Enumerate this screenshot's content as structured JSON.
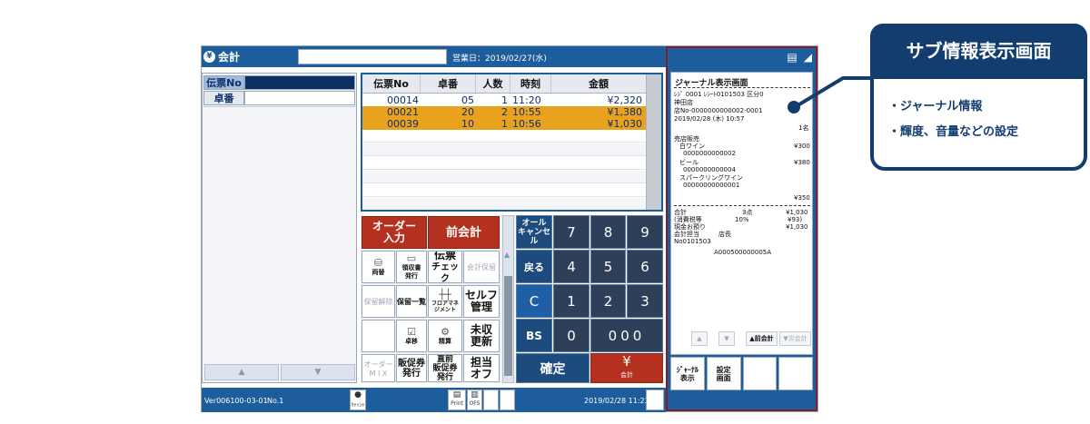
{
  "app": {
    "title": "会計",
    "business_date": "営業日：2019/02/27(水)"
  },
  "left_panel": {
    "rows": [
      {
        "label": "伝票No"
      },
      {
        "label": "卓番"
      }
    ],
    "nav_up": "▲",
    "nav_down": "▼"
  },
  "order_table": {
    "headers": [
      "伝票No",
      "卓番",
      "人数",
      "時刻",
      "金額"
    ],
    "rows": [
      {
        "no": "00014",
        "table": "05",
        "count": "1",
        "time": "11:20",
        "amount": "¥2,320"
      },
      {
        "no": "00021",
        "table": "20",
        "count": "2",
        "time": "10:55",
        "amount": "¥1,380"
      },
      {
        "no": "00039",
        "table": "10",
        "count": "1",
        "time": "10:56",
        "amount": "¥1,030"
      }
    ]
  },
  "functions": {
    "order_input": "オーダー入力",
    "prev_account": "前会計",
    "transfer_icon_label": "両替",
    "receipt_issue": "領収書発行",
    "slip_check_1": "伝票",
    "slip_check_2": "チェック",
    "account_hold": "会計保留",
    "hold_release": "保留解除",
    "hold_list": "保留一覧",
    "floor_mgmt": "フロアマネジメント",
    "self_mgmt_1": "セルフ",
    "self_mgmt_2": "管理",
    "table_move": "卓移",
    "settle": "精算",
    "unpaid_update_1": "未収",
    "unpaid_update_2": "更新",
    "order_mix_1": "オーダー",
    "order_mix_2": "M I X",
    "promo_ticket_1": "販促券",
    "promo_ticket_2": "発行",
    "direct_promo_1": "直前",
    "direct_promo_2": "販促券",
    "direct_promo_3": "発行",
    "staff_off_1": "担当",
    "staff_off_2": "オフ"
  },
  "keypad": {
    "all_cancel": "オール\nキャンセル",
    "back": "戻る",
    "clear": "C",
    "bs": "BS",
    "confirm": "確定",
    "yen": "¥",
    "yen_sub": "会計",
    "k7": "7",
    "k8": "8",
    "k9": "9",
    "k4": "4",
    "k5": "5",
    "k6": "6",
    "k1": "1",
    "k2": "2",
    "k3": "3",
    "k0": "0",
    "k000": "000"
  },
  "statusbar": {
    "version": "Ver006100-03-01",
    "register_no": "No.1",
    "cashier_label": "ｷｬｯｼｬ",
    "print_label": "Print",
    "ofs_label": "OFS",
    "datetime": "2019/02/28 11:23"
  },
  "journal": {
    "title": "ジャーナル表示画面",
    "lines": {
      "header1": "ﾚｼﾞ 0001 ﾚｼｰﾄ0101503 区分0",
      "store": "神田店",
      "slip": "店No-0000000000002-0001",
      "date": "2019/02/28 (木) 10:57",
      "people": "1名",
      "sale": "売店販売",
      "item1": "白ワイン",
      "item1_price": "¥300",
      "item1_code": "0000000000002",
      "item2": "ビール",
      "item2_price": "¥380",
      "item2_code": "0000000000004",
      "item3": "スパークリングワイン",
      "item3_code": "00000000000001",
      "item3_price": "¥350",
      "total_label": "合計",
      "total_qty": "3点",
      "total": "¥1,030",
      "tax_label": "(消費税等",
      "tax_rate": "10%",
      "tax": "¥93)",
      "change_label": "現金お預り",
      "change": "¥1,030",
      "staff_label": "会計担当",
      "staff": "店長",
      "receipt_no": "No0101503",
      "barcode": "A000500000005A"
    },
    "nav_up": "▲",
    "nav_down": "▼",
    "nav_prev": "▲前会計",
    "nav_next": "▼次会計"
  },
  "right_buttons": {
    "journal_display": "ｼﾞｬｰﾅﾙ\n表示",
    "settings_screen": "設定\n画面"
  },
  "callout": {
    "title": "サブ情報表示画面",
    "items": [
      "・ジャーナル情報",
      "・輝度、音量などの設定"
    ]
  },
  "colors": {
    "primary_blue": "#1d5d9b",
    "selected_row": "#e8a21e",
    "red_button": "#b5311f",
    "callout_navy": "#133d6e"
  }
}
